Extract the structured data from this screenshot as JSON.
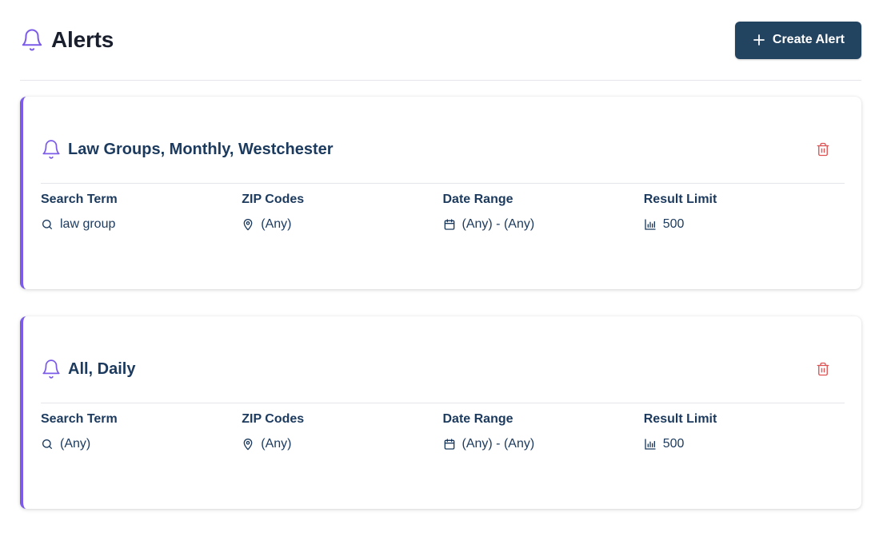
{
  "header": {
    "title": "Alerts",
    "create_button_label": "Create Alert"
  },
  "icons": {
    "bell": "bell-icon",
    "plus": "plus-icon",
    "trash": "trash-icon",
    "search": "search-icon",
    "location": "map-pin-icon",
    "calendar": "calendar-icon",
    "chart": "bar-chart-icon"
  },
  "colors": {
    "accent": "#7b5be8",
    "primary_button": "#234461",
    "text": "#1b3a5e",
    "delete": "#e05252"
  },
  "alerts": [
    {
      "title": "Law Groups, Monthly, Westchester",
      "fields": {
        "search_term_label": "Search Term",
        "search_term_value": "law group",
        "zip_codes_label": "ZIP Codes",
        "zip_codes_value": "(Any)",
        "date_range_label": "Date Range",
        "date_range_value": "(Any) - (Any)",
        "result_limit_label": "Result Limit",
        "result_limit_value": "500"
      }
    },
    {
      "title": "All, Daily",
      "fields": {
        "search_term_label": "Search Term",
        "search_term_value": "(Any)",
        "zip_codes_label": "ZIP Codes",
        "zip_codes_value": "(Any)",
        "date_range_label": "Date Range",
        "date_range_value": "(Any) - (Any)",
        "result_limit_label": "Result Limit",
        "result_limit_value": "500"
      }
    }
  ]
}
